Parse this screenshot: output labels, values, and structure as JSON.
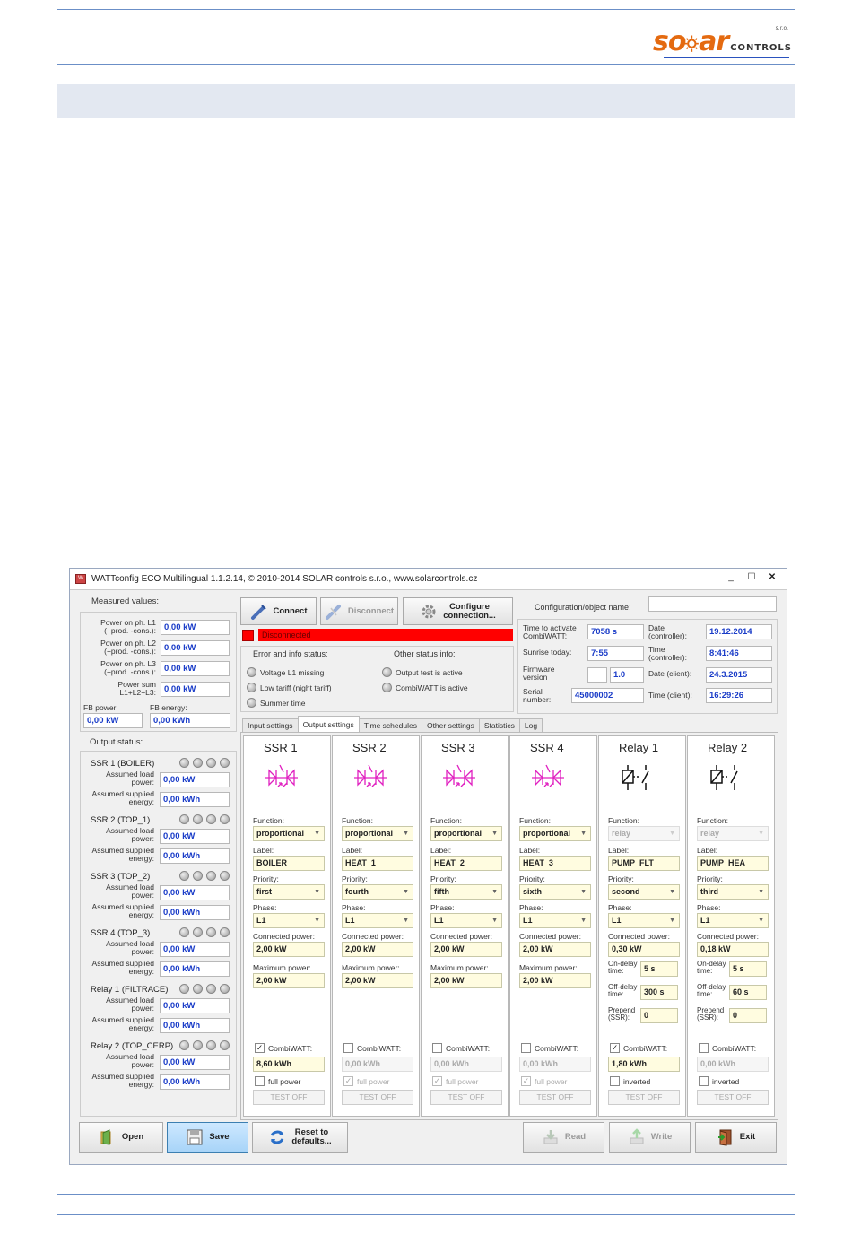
{
  "logo": {
    "brand_left": "so",
    "brand_right": "ar",
    "sub": "CONTROLS",
    "sro": "s.r.o."
  },
  "window": {
    "title": "WATTconfig ECO Multilingual 1.1.2.14, © 2010-2014 SOLAR controls s.r.o., www.solarcontrols.cz",
    "btn_min": "_",
    "btn_max": "☐",
    "btn_close": "✕"
  },
  "measured": {
    "title": "Measured values:",
    "rows": [
      {
        "label": "Power on ph. L1\n(+prod. -cons.):",
        "value": "0,00 kW"
      },
      {
        "label": "Power on ph. L2\n(+prod. -cons.):",
        "value": "0,00 kW"
      },
      {
        "label": "Power on ph. L3\n(+prod. -cons.):",
        "value": "0,00 kW"
      },
      {
        "label": "Power sum\nL1+L2+L3:",
        "value": "0,00 kW"
      }
    ],
    "fb_power_label": "FB power:",
    "fb_power": "0,00 kW",
    "fb_energy_label": "FB energy:",
    "fb_energy": "0,00 kWh"
  },
  "output_status": {
    "title": "Output status:",
    "load_label": "Assumed load\npower:",
    "energy_label": "Assumed supplied\nenergy:",
    "items": [
      {
        "name": "SSR 1 (BOILER)",
        "power": "0,00 kW",
        "energy": "0,00 kWh"
      },
      {
        "name": "SSR 2 (TOP_1)",
        "power": "0,00 kW",
        "energy": "0,00 kWh"
      },
      {
        "name": "SSR 3 (TOP_2)",
        "power": "0,00 kW",
        "energy": "0,00 kWh"
      },
      {
        "name": "SSR 4 (TOP_3)",
        "power": "0,00 kW",
        "energy": "0,00 kWh"
      },
      {
        "name": "Relay 1 (FILTRACE)",
        "power": "0,00 kW",
        "energy": "0,00 kWh"
      },
      {
        "name": "Relay 2 (TOP_CERP)",
        "power": "0,00 kW",
        "energy": "0,00 kWh"
      }
    ]
  },
  "toolbar": {
    "connect": "Connect",
    "disconnect": "Disconnect",
    "configure": "Configure\nconnection...",
    "status": "Disconnected"
  },
  "config_name_label": "Configuration/object name:",
  "info": {
    "error_title": "Error and info status:",
    "other_title": "Other status info:",
    "errors": [
      "Voltage L1 missing",
      "Low tariff (night tariff)",
      "Summer time"
    ],
    "others": [
      "Output test is active",
      "CombiWATT is active"
    ]
  },
  "times": {
    "activate_label": "Time to activate\nCombiWATT:",
    "activate": "7058 s",
    "sunrise_label": "Sunrise today:",
    "sunrise": "7:55",
    "firmware_label": "Firmware\nversion",
    "firmware": "1.0",
    "serial_label": "Serial\nnumber:",
    "serial": "45000002",
    "date_ctrl_label": "Date\n(controller):",
    "date_ctrl": "19.12.2014",
    "time_ctrl_label": "Time\n(controller):",
    "time_ctrl": "8:41:46",
    "date_client_label": "Date (client):",
    "date_client": "24.3.2015",
    "time_client_label": "Time (client):",
    "time_client": "16:29:26"
  },
  "tabs": [
    "Input settings",
    "Output settings",
    "Time schedules",
    "Other settings",
    "Statistics",
    "Log"
  ],
  "field_labels": {
    "function": "Function:",
    "label": "Label:",
    "priority": "Priority:",
    "phase": "Phase:",
    "connected": "Connected power:",
    "maximum": "Maximum power:",
    "on_delay": "On-delay\ntime:",
    "off_delay": "Off-delay\ntime:",
    "prepend": "Prepend\n(SSR):",
    "combiwatt": "CombiWATT:",
    "full_power": "full power",
    "inverted": "inverted",
    "test_off": "TEST OFF"
  },
  "outputs": [
    {
      "name": "SSR 1",
      "function": "proportional",
      "label": "BOILER",
      "priority": "first",
      "phase": "L1",
      "connected": "2,00 kW",
      "maximum": "2,00 kW",
      "combiwatt": true,
      "energy": "8,60 kWh",
      "full_power": false
    },
    {
      "name": "SSR 2",
      "function": "proportional",
      "label": "HEAT_1",
      "priority": "fourth",
      "phase": "L1",
      "connected": "2,00 kW",
      "maximum": "2,00 kW",
      "combiwatt": false,
      "energy": "0,00 kWh",
      "full_power": true
    },
    {
      "name": "SSR 3",
      "function": "proportional",
      "label": "HEAT_2",
      "priority": "fifth",
      "phase": "L1",
      "connected": "2,00 kW",
      "maximum": "2,00 kW",
      "combiwatt": false,
      "energy": "0,00 kWh",
      "full_power": true
    },
    {
      "name": "SSR 4",
      "function": "proportional",
      "label": "HEAT_3",
      "priority": "sixth",
      "phase": "L1",
      "connected": "2,00 kW",
      "maximum": "2,00 kW",
      "combiwatt": false,
      "energy": "0,00 kWh",
      "full_power": true
    },
    {
      "name": "Relay 1",
      "function": "relay",
      "label": "PUMP_FLT",
      "priority": "second",
      "phase": "L1",
      "connected": "0,30 kW",
      "on_delay": "5 s",
      "off_delay": "300 s",
      "prepend": "0",
      "combiwatt": true,
      "energy": "1,80 kWh",
      "inverted": false
    },
    {
      "name": "Relay 2",
      "function": "relay",
      "label": "PUMP_HEA",
      "priority": "third",
      "phase": "L1",
      "connected": "0,18 kW",
      "on_delay": "5 s",
      "off_delay": "60 s",
      "prepend": "0",
      "combiwatt": false,
      "energy": "0,00 kWh",
      "inverted": false
    }
  ],
  "bottom": {
    "open": "Open",
    "save": "Save",
    "reset": "Reset to\ndefaults...",
    "read": "Read",
    "write": "Write",
    "exit": "Exit"
  },
  "colors": {
    "accent": "#e46a10",
    "value_blue": "#1a3cc8",
    "status_red": "#ff0000"
  }
}
